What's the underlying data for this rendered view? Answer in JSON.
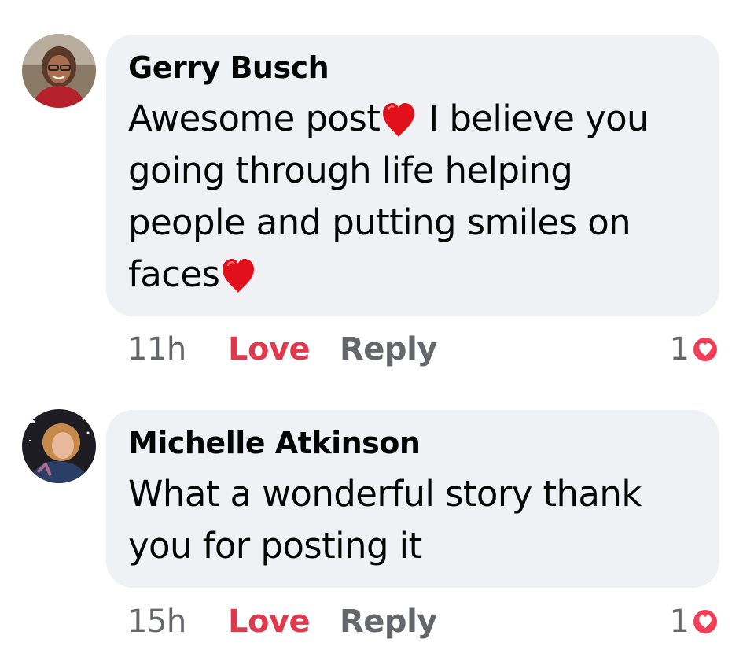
{
  "comments": [
    {
      "author": "Gerry Busch",
      "text_parts": [
        "Awesome post",
        " I believe you going through life helping people and putting smiles on faces",
        ""
      ],
      "emoji": "red-heart",
      "time": "11h",
      "love_label": "Love",
      "reply_label": "Reply",
      "reaction_count": "1",
      "reaction_type": "love"
    },
    {
      "author": "Michelle Atkinson",
      "text": "What a wonderful story thank you for posting it",
      "time": "15h",
      "love_label": "Love",
      "reply_label": "Reply",
      "reaction_count": "1",
      "reaction_type": "love"
    }
  ],
  "colors": {
    "bubble": "#eff1f4",
    "love": "#e0384d",
    "meta": "#65676b",
    "reaction": "#f33e58"
  }
}
